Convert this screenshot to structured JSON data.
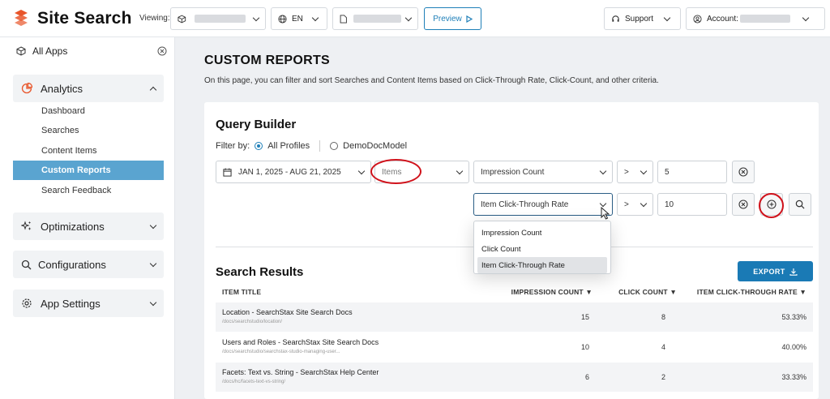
{
  "header": {
    "app_title": "Site Search",
    "viewing_label": "Viewing:",
    "language": "EN",
    "preview_label": "Preview",
    "support_label": "Support",
    "account_label": "Account:"
  },
  "sidebar": {
    "all_apps": "All Apps",
    "analytics": "Analytics",
    "sub_items": [
      "Dashboard",
      "Searches",
      "Content Items",
      "Custom Reports",
      "Search Feedback"
    ],
    "active_item": "Custom Reports",
    "optimizations": "Optimizations",
    "configurations": "Configurations",
    "app_settings": "App Settings"
  },
  "page": {
    "title": "CUSTOM REPORTS",
    "description": "On this page, you can filter and sort Searches and Content Items based on Click-Through Rate, Click-Count, and other criteria."
  },
  "query_builder": {
    "title": "Query Builder",
    "filter_by": "Filter by:",
    "profile_all": "All Profiles",
    "profile_demo": "DemoDocModel",
    "date_range": "JAN 1, 2025 - AUG 21, 2025",
    "type_value": "Items",
    "row1": {
      "metric": "Impression Count",
      "operator": ">",
      "value": "5"
    },
    "row2": {
      "metric": "Item Click-Through Rate",
      "operator": ">",
      "value": "10"
    },
    "dropdown_options": [
      "Impression Count",
      "Click Count",
      "Item Click-Through Rate"
    ],
    "dropdown_selected": "Item Click-Through Rate"
  },
  "results": {
    "title": "Search Results",
    "export_label": "EXPORT",
    "columns": [
      "ITEM TITLE",
      "IMPRESSION COUNT ▼",
      "CLICK COUNT ▼",
      "ITEM CLICK-THROUGH RATE ▼"
    ],
    "rows": [
      {
        "title": "Location - SearchStax Site Search Docs",
        "url": "/docs/searchstudio/location/",
        "impressions": "15",
        "clicks": "8",
        "ctr": "53.33%"
      },
      {
        "title": "Users and Roles - SearchStax Site Search Docs",
        "url": "/docs/searchstudio/searchstax-studio-managing-user...",
        "impressions": "10",
        "clicks": "4",
        "ctr": "40.00%"
      },
      {
        "title": "Facets: Text vs. String - SearchStax Help Center",
        "url": "/docs/hc/facets-text-vs-string/",
        "impressions": "6",
        "clicks": "2",
        "ctr": "33.33%"
      }
    ]
  },
  "colors": {
    "brand": "#e8552a",
    "accent": "#1a7ab5",
    "active_nav": "#5aa4d0",
    "highlight_ring": "#d0121b"
  }
}
